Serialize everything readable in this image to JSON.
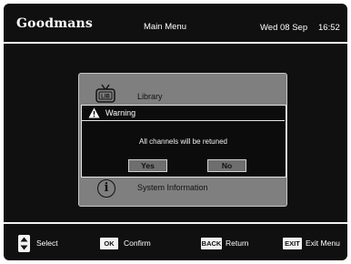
{
  "header": {
    "brand": "Goodmans",
    "menu_title": "Main Menu",
    "date": "Wed 08 Sep",
    "time": "16:52"
  },
  "menu": {
    "items": [
      {
        "label": "Library",
        "icon": "tv-library-icon"
      },
      {
        "label": "System Information",
        "icon": "info-icon"
      }
    ]
  },
  "warning": {
    "icon": "warning-icon",
    "title": "Warning",
    "message": "All channels will be retuned",
    "yes_label": "Yes",
    "no_label": "No",
    "selected": "No"
  },
  "footer": {
    "select_icon": "up-down-arrows-icon",
    "select_label": "Select",
    "ok_key": "OK",
    "confirm_label": "Confirm",
    "back_key": "BACK",
    "return_label": "Return",
    "exit_key": "EXIT",
    "exit_label": "Exit Menu"
  },
  "colors": {
    "screen_background": "#101010",
    "panel_background": "#7f7f7f",
    "button_background": "#6e6e6e",
    "text_light": "#ffffff"
  }
}
